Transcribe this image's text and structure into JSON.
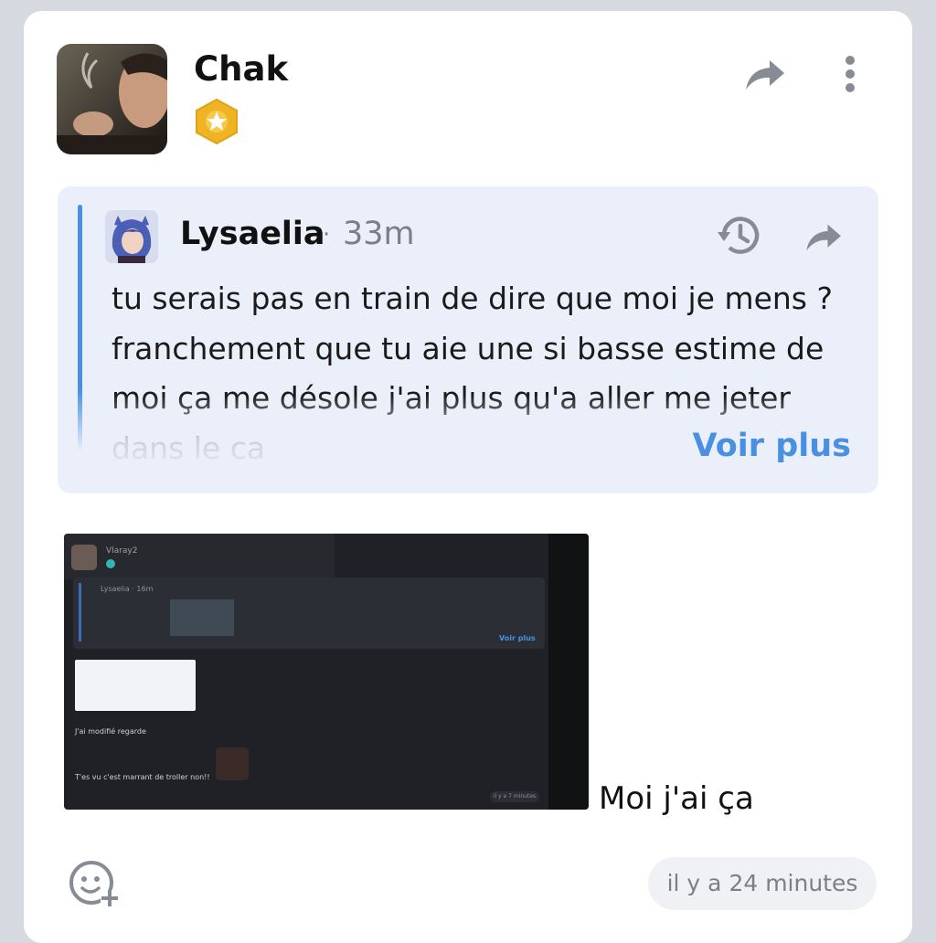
{
  "post": {
    "author": "Chak",
    "badge_icon": "gold-star-hexagon-icon",
    "header_actions": [
      "share-icon",
      "more-vertical-icon"
    ]
  },
  "quote": {
    "author": "Lysaelia",
    "separator": "·",
    "time": "33m",
    "text": "tu serais pas en train de dire que moi je mens ? franchement que tu aie une si basse estime de moi ça me désole j'ai plus qu'a aller me jeter dans le ca",
    "more_label": "Voir plus",
    "accent_color": "#4a90e2",
    "actions": [
      "history-icon",
      "share-icon"
    ]
  },
  "embedded_screenshot": {
    "author": "Vlaray2",
    "quote_author": "Lysaelia · 16m",
    "more_label": "Voir plus",
    "line1": "J'ai modifié regarde",
    "line2": "T'es vu c'est marrant de troller non!!",
    "time": "il y a 7 minutes"
  },
  "message": {
    "caption": "Moi j'ai ça"
  },
  "footer": {
    "reaction_icon": "add-reaction-icon",
    "timestamp": "il y a 24 minutes"
  },
  "colors": {
    "background": "#d6d9df",
    "card": "#ffffff",
    "quote_bg": "#eaeffa",
    "link": "#4a90e2",
    "muted": "#7a7f88"
  }
}
